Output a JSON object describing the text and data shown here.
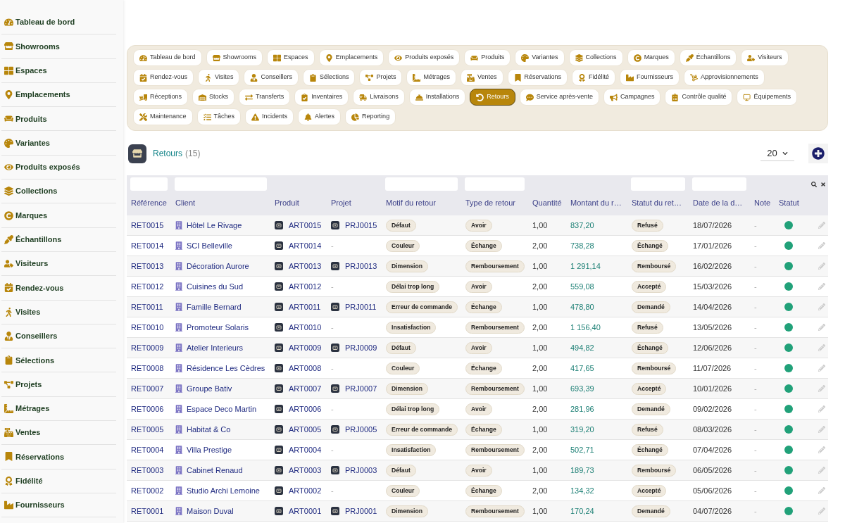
{
  "sidebar": {
    "items": [
      {
        "label": "Tableau de bord",
        "selected": false
      },
      {
        "label": "Showrooms",
        "selected": false
      },
      {
        "label": "Espaces",
        "selected": false
      },
      {
        "label": "Emplacements",
        "selected": false
      },
      {
        "label": "Produits",
        "selected": false
      },
      {
        "label": "Variantes",
        "selected": false
      },
      {
        "label": "Produits exposés",
        "selected": false
      },
      {
        "label": "Collections",
        "selected": false
      },
      {
        "label": "Marques",
        "selected": false
      },
      {
        "label": "Échantillons",
        "selected": false
      },
      {
        "label": "Visiteurs",
        "selected": false
      },
      {
        "label": "Rendez-vous",
        "selected": false
      },
      {
        "label": "Visites",
        "selected": false
      },
      {
        "label": "Conseillers",
        "selected": false
      },
      {
        "label": "Sélections",
        "selected": false
      },
      {
        "label": "Projets",
        "selected": false
      },
      {
        "label": "Métrages",
        "selected": false
      },
      {
        "label": "Ventes",
        "selected": false
      },
      {
        "label": "Réservations",
        "selected": false
      },
      {
        "label": "Fidélité",
        "selected": false
      },
      {
        "label": "Fournisseurs",
        "selected": false
      }
    ]
  },
  "tab_rows": [
    [
      {
        "label": "Tableau de bord",
        "selected": false
      },
      {
        "label": "Showrooms",
        "selected": false
      },
      {
        "label": "Espaces",
        "selected": false
      },
      {
        "label": "Emplacements",
        "selected": false
      },
      {
        "label": "Produits exposés",
        "selected": false
      },
      {
        "label": "Produits",
        "selected": false
      },
      {
        "label": "Variantes",
        "selected": false
      },
      {
        "label": "Collections",
        "selected": false
      },
      {
        "label": "Marques",
        "selected": false
      },
      {
        "label": "Échantillons",
        "selected": false
      },
      {
        "label": "Visiteurs",
        "selected": false
      }
    ],
    [
      {
        "label": "Rendez-vous",
        "selected": false
      },
      {
        "label": "Visites",
        "selected": false
      },
      {
        "label": "Conseillers",
        "selected": false
      },
      {
        "label": "Sélections",
        "selected": false
      },
      {
        "label": "Projets",
        "selected": false
      },
      {
        "label": "Métrages",
        "selected": false
      },
      {
        "label": "Ventes",
        "selected": false
      },
      {
        "label": "Réservations",
        "selected": false
      },
      {
        "label": "Fidélité",
        "selected": false
      },
      {
        "label": "Fournisseurs",
        "selected": false
      },
      {
        "label": "Approvisionnements",
        "selected": false
      }
    ],
    [
      {
        "label": "Réceptions",
        "selected": false
      },
      {
        "label": "Stocks",
        "selected": false
      },
      {
        "label": "Transferts",
        "selected": false
      },
      {
        "label": "Inventaires",
        "selected": false
      },
      {
        "label": "Livraisons",
        "selected": false
      },
      {
        "label": "Installations",
        "selected": false
      },
      {
        "label": "Retours",
        "selected": true
      },
      {
        "label": "Service après-vente",
        "selected": false
      },
      {
        "label": "Campagnes",
        "selected": false
      },
      {
        "label": "Contrôle qualité",
        "selected": false
      },
      {
        "label": "Équipements",
        "selected": false
      }
    ],
    [
      {
        "label": "Maintenance",
        "selected": false
      },
      {
        "label": "Tâches",
        "selected": false
      },
      {
        "label": "Incidents",
        "selected": false
      },
      {
        "label": "Alertes",
        "selected": false
      },
      {
        "label": "Reporting",
        "selected": false
      }
    ]
  ],
  "list_header": {
    "title": "Retours",
    "count": "(15)",
    "page_size": "20"
  },
  "table": {
    "columns": [
      {
        "label": "Référence",
        "filter": true
      },
      {
        "label": "Client",
        "filter": true
      },
      {
        "label": "Produit",
        "filter": false
      },
      {
        "label": "Projet",
        "filter": false
      },
      {
        "label": "Motif du retour",
        "filter": true
      },
      {
        "label": "Type de retour",
        "filter": true
      },
      {
        "label": "Quantité",
        "filter": false
      },
      {
        "label": "Montant du r…",
        "filter": false
      },
      {
        "label": "Statut du ret…",
        "filter": true
      },
      {
        "label": "Date de la d…",
        "filter": true
      },
      {
        "label": "Note",
        "filter": false
      },
      {
        "label": "Statut",
        "filter": false
      }
    ],
    "rows": [
      {
        "reference": "RET0015",
        "client": "Hôtel Le Rivage",
        "produit": "ART0015",
        "projet": {
          "text": "PRJ0015",
          "linked": true
        },
        "motif": "Défaut",
        "type": "Avoir",
        "quantite": "1,00",
        "montant": "837,20",
        "statut_retour": "Refusé",
        "date": "18/07/2026",
        "note": "-",
        "active": true
      },
      {
        "reference": "RET0014",
        "client": "SCI Belleville",
        "produit": "ART0014",
        "projet": {
          "text": "-",
          "linked": false
        },
        "motif": "Couleur",
        "type": "Échange",
        "quantite": "2,00",
        "montant": "738,28",
        "statut_retour": "Échangé",
        "date": "17/01/2026",
        "note": "-",
        "active": true
      },
      {
        "reference": "RET0013",
        "client": "Décoration Aurore",
        "produit": "ART0013",
        "projet": {
          "text": "PRJ0013",
          "linked": true
        },
        "motif": "Dimension",
        "type": "Remboursement",
        "quantite": "1,00",
        "montant": "1 291,14",
        "statut_retour": "Remboursé",
        "date": "16/02/2026",
        "note": "-",
        "active": true
      },
      {
        "reference": "RET0012",
        "client": "Cuisines du Sud",
        "produit": "ART0012",
        "projet": {
          "text": "-",
          "linked": false
        },
        "motif": "Délai trop long",
        "type": "Avoir",
        "quantite": "2,00",
        "montant": "559,08",
        "statut_retour": "Accepté",
        "date": "15/03/2026",
        "note": "-",
        "active": true
      },
      {
        "reference": "RET0011",
        "client": "Famille Bernard",
        "produit": "ART0011",
        "projet": {
          "text": "PRJ0011",
          "linked": true
        },
        "motif": "Erreur de commande",
        "type": "Échange",
        "quantite": "1,00",
        "montant": "478,80",
        "statut_retour": "Demandé",
        "date": "14/04/2026",
        "note": "-",
        "active": true
      },
      {
        "reference": "RET0010",
        "client": "Promoteur Solaris",
        "produit": "ART0010",
        "projet": {
          "text": "-",
          "linked": false
        },
        "motif": "Insatisfaction",
        "type": "Remboursement",
        "quantite": "2,00",
        "montant": "1 156,40",
        "statut_retour": "Refusé",
        "date": "13/05/2026",
        "note": "-",
        "active": true
      },
      {
        "reference": "RET0009",
        "client": "Atelier Interieurs",
        "produit": "ART0009",
        "projet": {
          "text": "PRJ0009",
          "linked": true
        },
        "motif": "Défaut",
        "type": "Avoir",
        "quantite": "1,00",
        "montant": "494,82",
        "statut_retour": "Échangé",
        "date": "12/06/2026",
        "note": "-",
        "active": true
      },
      {
        "reference": "RET0008",
        "client": "Résidence Les Cèdres",
        "produit": "ART0008",
        "projet": {
          "text": "-",
          "linked": false
        },
        "motif": "Couleur",
        "type": "Échange",
        "quantite": "2,00",
        "montant": "417,65",
        "statut_retour": "Remboursé",
        "date": "11/07/2026",
        "note": "-",
        "active": true
      },
      {
        "reference": "RET0007",
        "client": "Groupe Bativ",
        "produit": "ART0007",
        "projet": {
          "text": "PRJ0007",
          "linked": true
        },
        "motif": "Dimension",
        "type": "Remboursement",
        "quantite": "1,00",
        "montant": "693,39",
        "statut_retour": "Accepté",
        "date": "10/01/2026",
        "note": "-",
        "active": true
      },
      {
        "reference": "RET0006",
        "client": "Espace Deco Martin",
        "produit": "ART0006",
        "projet": {
          "text": "-",
          "linked": false
        },
        "motif": "Délai trop long",
        "type": "Avoir",
        "quantite": "2,00",
        "montant": "281,96",
        "statut_retour": "Demandé",
        "date": "09/02/2026",
        "note": "-",
        "active": true
      },
      {
        "reference": "RET0005",
        "client": "Habitat & Co",
        "produit": "ART0005",
        "projet": {
          "text": "PRJ0005",
          "linked": true
        },
        "motif": "Erreur de commande",
        "type": "Échange",
        "quantite": "1,00",
        "montant": "319,20",
        "statut_retour": "Refusé",
        "date": "08/03/2026",
        "note": "-",
        "active": true
      },
      {
        "reference": "RET0004",
        "client": "Villa Prestige",
        "produit": "ART0004",
        "projet": {
          "text": "-",
          "linked": false
        },
        "motif": "Insatisfaction",
        "type": "Remboursement",
        "quantite": "2,00",
        "montant": "502,71",
        "statut_retour": "Échangé",
        "date": "07/04/2026",
        "note": "-",
        "active": true
      },
      {
        "reference": "RET0003",
        "client": "Cabinet Renaud",
        "produit": "ART0003",
        "projet": {
          "text": "PRJ0003",
          "linked": true
        },
        "motif": "Défaut",
        "type": "Avoir",
        "quantite": "1,00",
        "montant": "189,73",
        "statut_retour": "Remboursé",
        "date": "06/05/2026",
        "note": "-",
        "active": true
      },
      {
        "reference": "RET0002",
        "client": "Studio Archi Lemoine",
        "produit": "ART0002",
        "projet": {
          "text": "-",
          "linked": false
        },
        "motif": "Couleur",
        "type": "Échange",
        "quantite": "2,00",
        "montant": "134,32",
        "statut_retour": "Accepté",
        "date": "05/06/2026",
        "note": "-",
        "active": true
      },
      {
        "reference": "RET0001",
        "client": "Maison Duval",
        "produit": "ART0001",
        "projet": {
          "text": "PRJ0001",
          "linked": true
        },
        "motif": "Dimension",
        "type": "Remboursement",
        "quantite": "1,00",
        "montant": "170,24",
        "statut_retour": "Demandé",
        "date": "04/07/2026",
        "note": "-",
        "active": true
      }
    ]
  }
}
